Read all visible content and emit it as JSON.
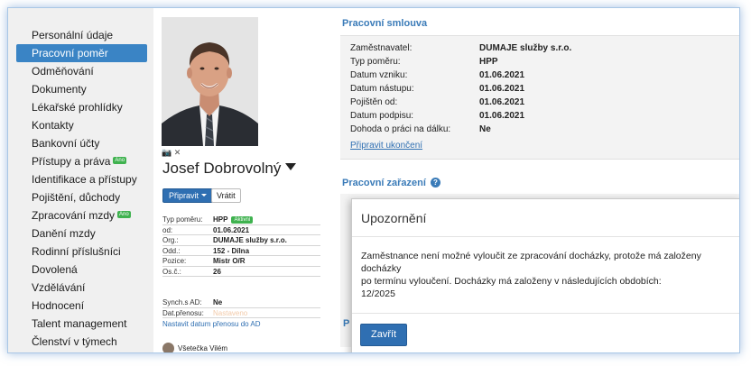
{
  "sidebar": {
    "items": [
      {
        "label": "Personální údaje",
        "active": false
      },
      {
        "label": "Pracovní poměr",
        "active": true
      },
      {
        "label": "Odměňování",
        "active": false
      },
      {
        "label": "Dokumenty",
        "active": false
      },
      {
        "label": "Lékařské prohlídky",
        "active": false
      },
      {
        "label": "Kontakty",
        "active": false
      },
      {
        "label": "Bankovní účty",
        "active": false
      },
      {
        "label": "Přístupy a práva",
        "active": false,
        "badge": "Ano"
      },
      {
        "label": "Identifikace a přístupy",
        "active": false
      },
      {
        "label": "Pojištění, důchody",
        "active": false
      },
      {
        "label": "Zpracování mzdy",
        "active": false,
        "badge": "Ano"
      },
      {
        "label": "Danění mzdy",
        "active": false
      },
      {
        "label": "Rodinní příslušníci",
        "active": false
      },
      {
        "label": "Dovolená",
        "active": false
      },
      {
        "label": "Vzdělávání",
        "active": false
      },
      {
        "label": "Hodnocení",
        "active": false
      },
      {
        "label": "Talent management",
        "active": false
      },
      {
        "label": "Členství v týmech",
        "active": false
      }
    ]
  },
  "profile": {
    "name": "Josef Dobrovolný",
    "photo_icons": "📷 ✕",
    "primary_button": "Připravit",
    "secondary_button": "Vrátit",
    "info": [
      {
        "key": "Typ poměru:",
        "value": "HPP",
        "badge": "Aktivní"
      },
      {
        "key": "od:",
        "value": "01.06.2021"
      },
      {
        "key": "Org.:",
        "value": "DUMAJE služby s.r.o."
      },
      {
        "key": "Odd.:",
        "value": "152 - Dílna"
      },
      {
        "key": "Pozice:",
        "value": "Mistr O/R"
      },
      {
        "key": "Os.č.:",
        "value": "26"
      }
    ],
    "sync": [
      {
        "key": "Synch.s AD:",
        "value": "Ne"
      },
      {
        "key": "Dat.přenosu:",
        "value": "Nastaveno"
      }
    ],
    "sync_link": "Nastavit datum přenosu do AD",
    "colleague": "Všetečka Vilém"
  },
  "contract": {
    "title": "Pracovní smlouva",
    "rows": [
      {
        "key": "Zaměstnavatel:",
        "value": "DUMAJE služby s.r.o."
      },
      {
        "key": "Typ poměru:",
        "value": "HPP"
      },
      {
        "key": "Datum vzniku:",
        "value": "01.06.2021"
      },
      {
        "key": "Datum nástupu:",
        "value": "01.06.2021"
      },
      {
        "key": "Pojištěn od:",
        "value": "01.06.2021"
      },
      {
        "key": "Datum podpisu:",
        "value": "01.06.2021"
      },
      {
        "key": "Dohoda o práci na dálku:",
        "value": "Ne"
      }
    ],
    "link": "Připravit ukončení"
  },
  "assignment": {
    "title": "Pracovní zařazení",
    "help_icon": "?"
  },
  "background_section_letter": "P",
  "modal": {
    "title": "Upozornění",
    "message_line1": "Zaměstnance není možné vyloučit ze zpracování docházky, protože má založeny docházky",
    "message_line2": "po termínu vyloučení. Docházky má založeny v následujících obdobích:",
    "message_line3": "12/2025",
    "close_button": "Zavřít"
  },
  "colors": {
    "accent": "#3a84c5",
    "section_title": "#3a7bb8",
    "badge_green": "#3fb24f"
  }
}
